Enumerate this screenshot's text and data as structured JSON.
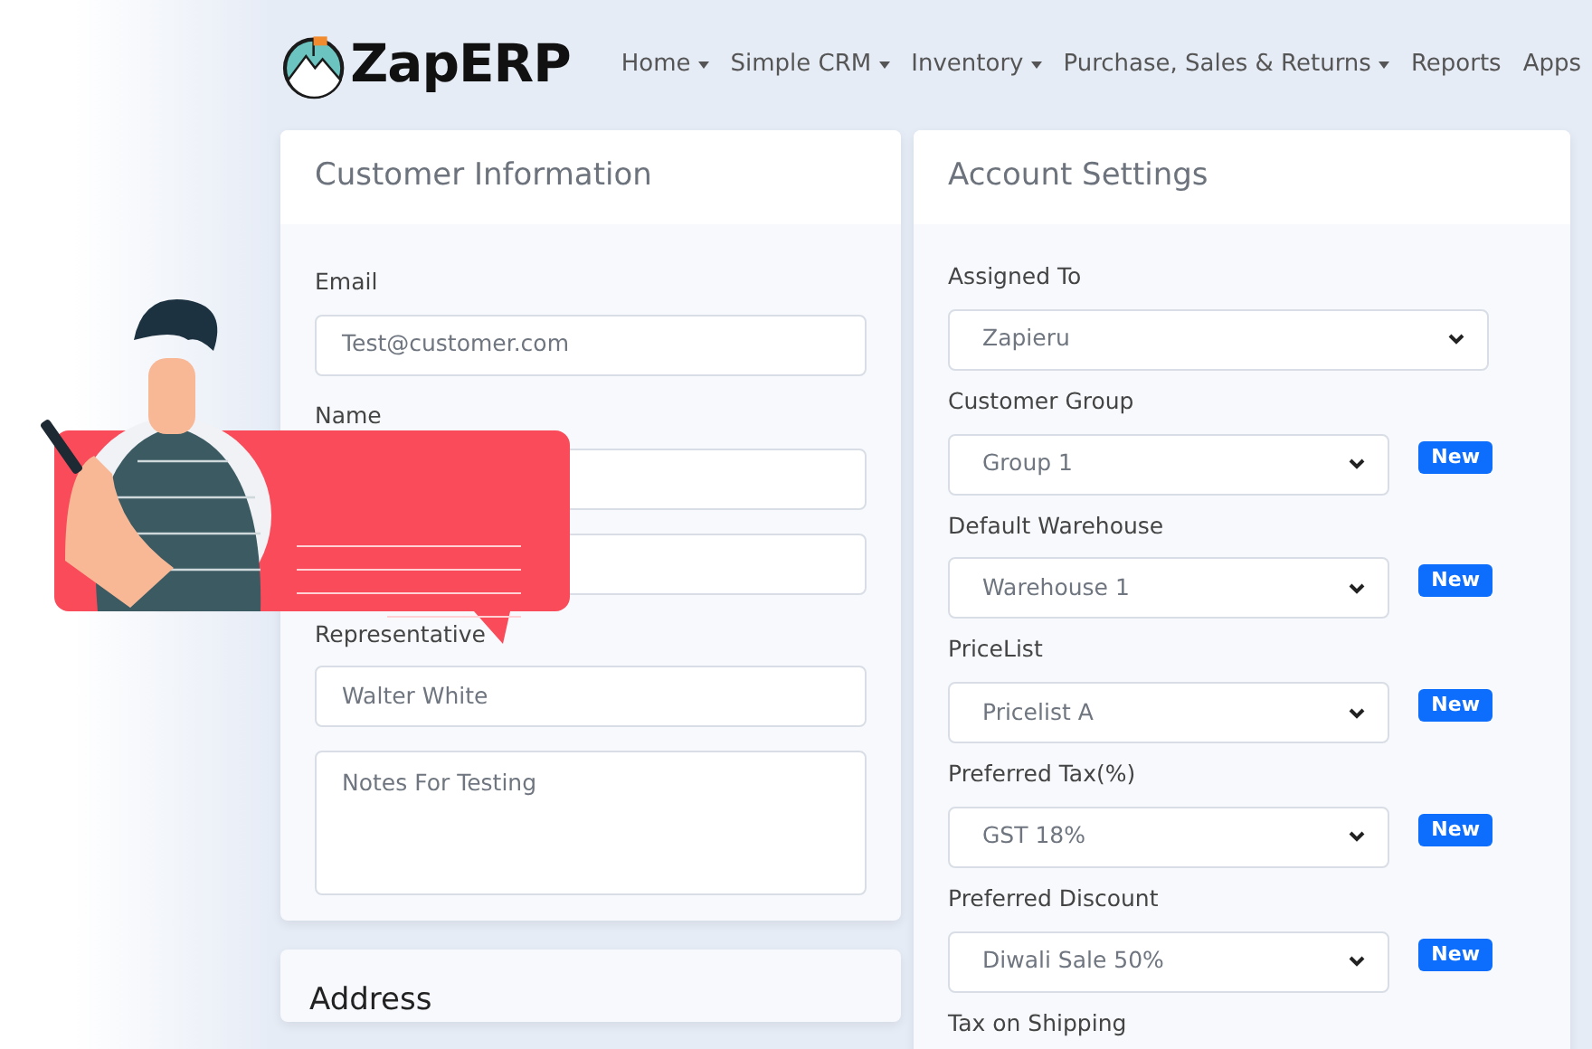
{
  "brand": "ZapERP",
  "nav": [
    {
      "label": "Home",
      "dropdown": true
    },
    {
      "label": "Simple CRM",
      "dropdown": true
    },
    {
      "label": "Inventory",
      "dropdown": true
    },
    {
      "label": "Purchase, Sales & Returns",
      "dropdown": true
    },
    {
      "label": "Reports",
      "dropdown": false
    },
    {
      "label": "Apps",
      "dropdown": false
    }
  ],
  "customer_information": {
    "title": "Customer Information",
    "fields": [
      {
        "kind": "input",
        "label": "Email",
        "value": "Test@customer.com"
      },
      {
        "kind": "input",
        "label": "Name"
      },
      {
        "kind": "input"
      },
      {
        "kind": "input",
        "label": "Representative",
        "value": "Walter White"
      },
      {
        "kind": "textarea",
        "value": "Notes For Testing"
      }
    ]
  },
  "account_settings": {
    "title": "Account Settings",
    "fields": [
      {
        "kind": "select",
        "label": "Assigned To",
        "value": "Zapieru"
      },
      {
        "kind": "select",
        "label": "Customer Group",
        "value": "Group 1",
        "action": "New"
      },
      {
        "kind": "select",
        "label": "Default Warehouse",
        "value": "Warehouse 1",
        "action": "New"
      },
      {
        "kind": "select",
        "label": "PriceList",
        "value": "Pricelist A",
        "action": "New"
      },
      {
        "kind": "select",
        "label": "Preferred Tax(%)",
        "value": "GST 18%",
        "action": "New"
      },
      {
        "kind": "select",
        "label": "Preferred Discount",
        "value": "Diwali Sale 50%",
        "action": "New"
      },
      {
        "kind": "label",
        "label": "Tax on Shipping"
      }
    ]
  },
  "address": {
    "title": "Address"
  }
}
